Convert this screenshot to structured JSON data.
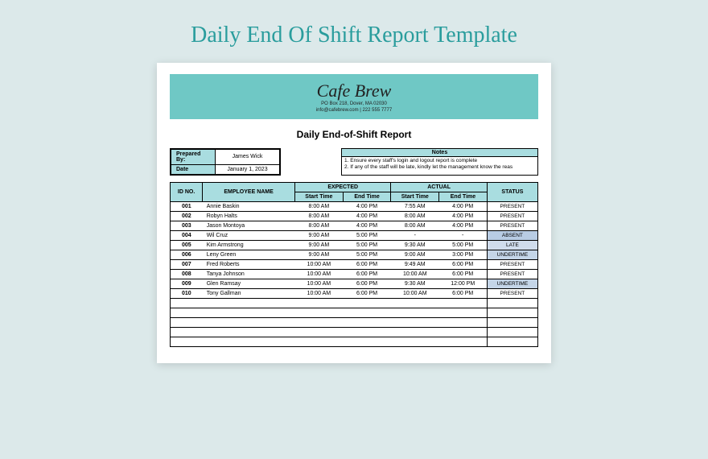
{
  "page_title": "Daily End Of Shift Report Template",
  "brand": {
    "name": "Cafe Brew",
    "address": "PO Box 218, Dover, MA 02030",
    "contact": "info@cafebrew.com | 222 555 7777"
  },
  "report_title": "Daily End-of-Shift Report",
  "meta": {
    "prepared_by_label": "Prepared By:",
    "prepared_by_value": "James Wick",
    "date_label": "Date",
    "date_value": "January 1, 2023"
  },
  "notes": {
    "header": "Notes",
    "line1": "1. Ensure every staff's login and logout report is complete",
    "line2": "2. If any of the staff will be late, kindly let the management know the reas"
  },
  "headers": {
    "id": "ID NO.",
    "name": "EMPLOYEE NAME",
    "expected": "EXPECTED",
    "actual": "ACTUAL",
    "status": "STATUS",
    "start": "Start Time",
    "end": "End Time"
  },
  "rows": [
    {
      "id": "001",
      "name": "Annie Baskin",
      "exp_start": "8:00 AM",
      "exp_end": "4:00 PM",
      "act_start": "7:55 AM",
      "act_end": "4:00 PM",
      "status": "PRESENT",
      "cls": "status-present"
    },
    {
      "id": "002",
      "name": "Robyn Halts",
      "exp_start": "8:00 AM",
      "exp_end": "4:00 PM",
      "act_start": "8:00 AM",
      "act_end": "4:00 PM",
      "status": "PRESENT",
      "cls": "status-present"
    },
    {
      "id": "003",
      "name": "Jason Montoya",
      "exp_start": "8:00 AM",
      "exp_end": "4:00 PM",
      "act_start": "8:00 AM",
      "act_end": "4:00 PM",
      "status": "PRESENT",
      "cls": "status-present"
    },
    {
      "id": "004",
      "name": "Wil Cruz",
      "exp_start": "9:00 AM",
      "exp_end": "5:00 PM",
      "act_start": "-",
      "act_end": "-",
      "status": "ABSENT",
      "cls": "status-absent"
    },
    {
      "id": "005",
      "name": "Kim Armstrong",
      "exp_start": "9:00 AM",
      "exp_end": "5:00 PM",
      "act_start": "9:30 AM",
      "act_end": "5:00 PM",
      "status": "LATE",
      "cls": "status-late"
    },
    {
      "id": "006",
      "name": "Leny Green",
      "exp_start": "9:00 AM",
      "exp_end": "5:00 PM",
      "act_start": "9:00 AM",
      "act_end": "3:00 PM",
      "status": "UNDERTIME",
      "cls": "status-undertime"
    },
    {
      "id": "007",
      "name": "Fred Roberts",
      "exp_start": "10:00 AM",
      "exp_end": "6:00 PM",
      "act_start": "9:49 AM",
      "act_end": "6:00 PM",
      "status": "PRESENT",
      "cls": "status-present"
    },
    {
      "id": "008",
      "name": "Tanya Johnson",
      "exp_start": "10:00 AM",
      "exp_end": "6:00 PM",
      "act_start": "10:00 AM",
      "act_end": "6:00 PM",
      "status": "PRESENT",
      "cls": "status-present"
    },
    {
      "id": "009",
      "name": "Glen Ramsay",
      "exp_start": "10:00 AM",
      "exp_end": "6:00 PM",
      "act_start": "9:30 AM",
      "act_end": "12:00 PM",
      "status": "UNDERTIME",
      "cls": "status-undertime"
    },
    {
      "id": "010",
      "name": "Tony Gallman",
      "exp_start": "10:00 AM",
      "exp_end": "6:00 PM",
      "act_start": "10:00 AM",
      "act_end": "6:00 PM",
      "status": "PRESENT",
      "cls": "status-present"
    }
  ],
  "empty_rows": 5
}
